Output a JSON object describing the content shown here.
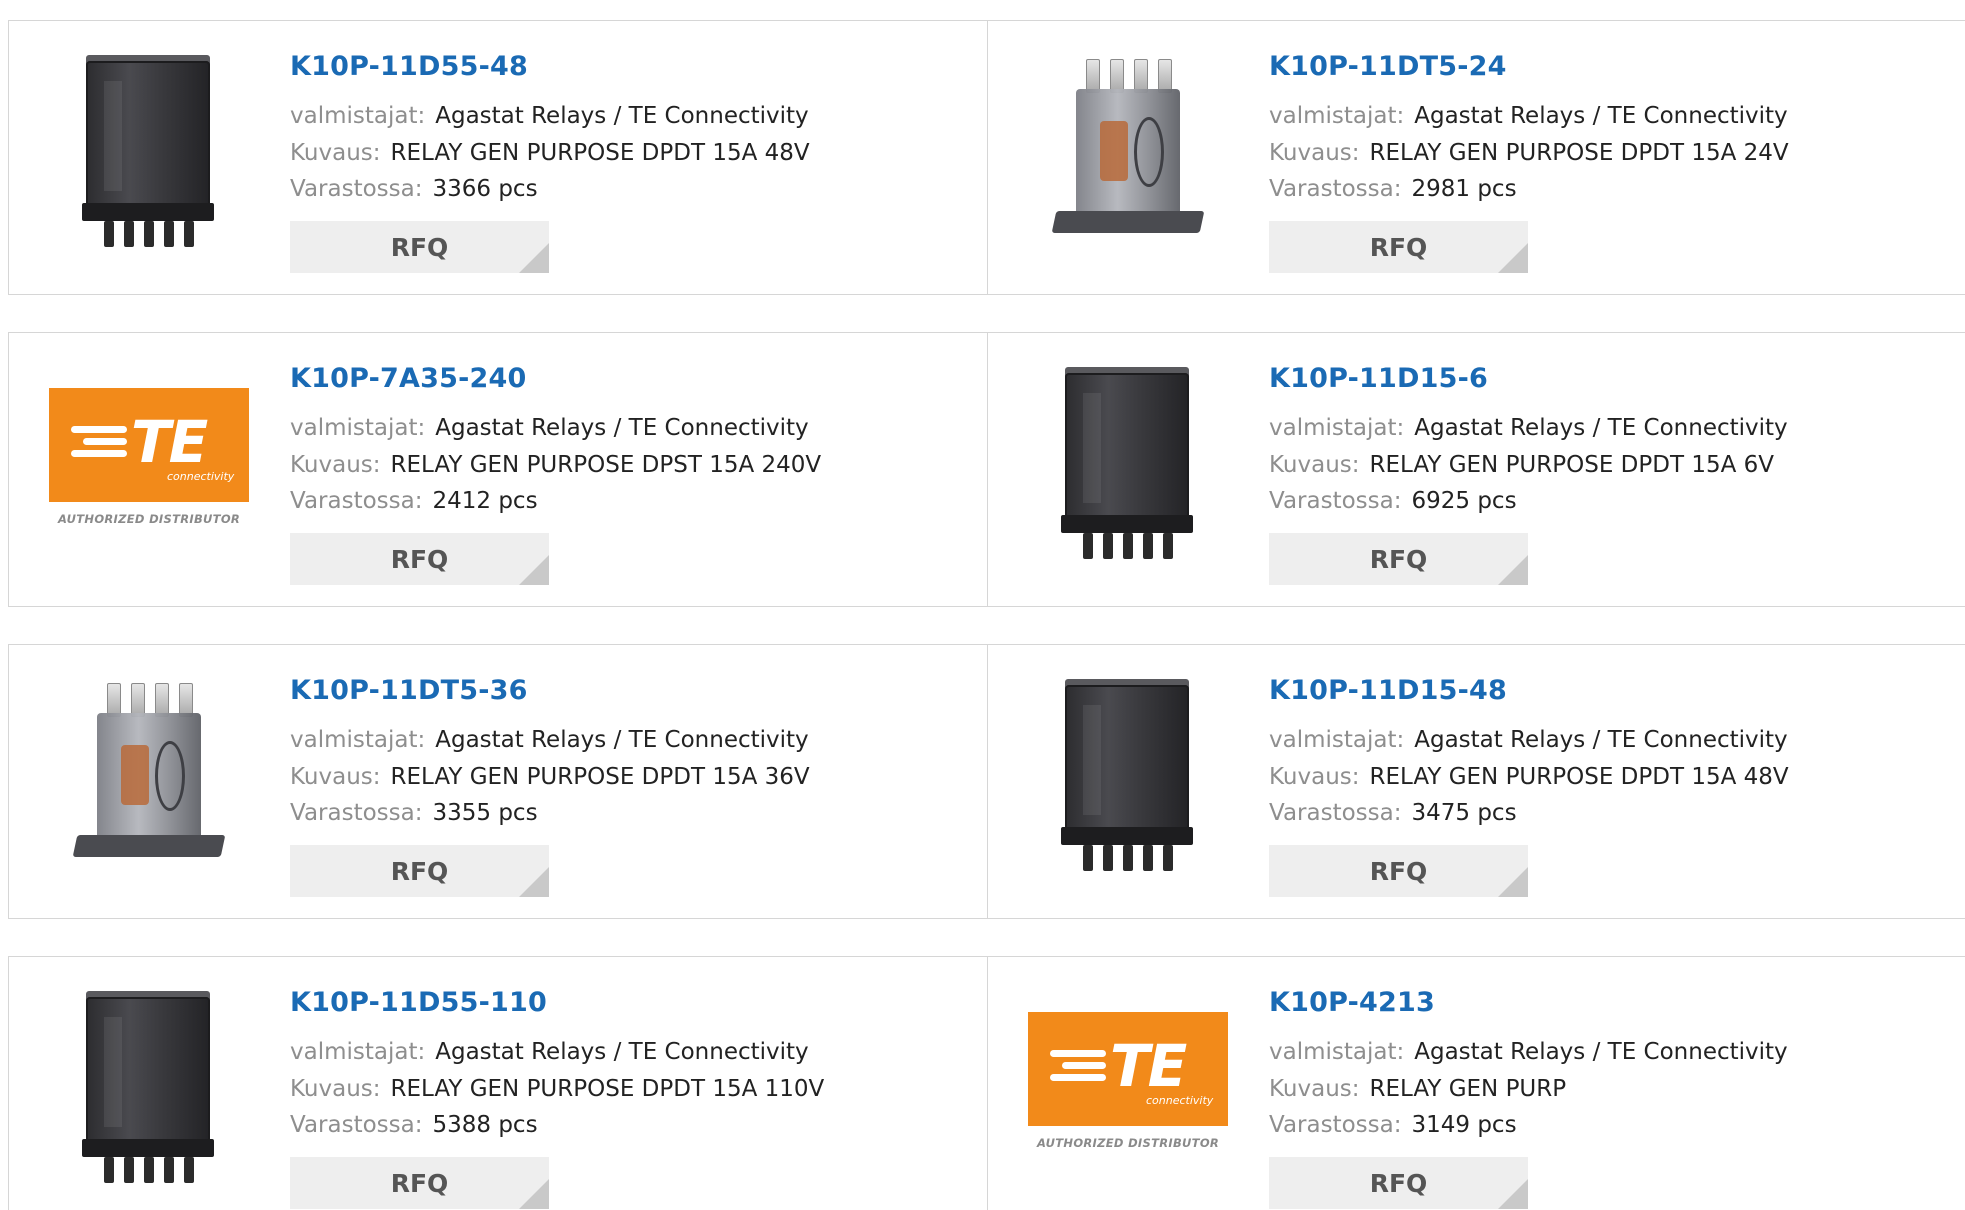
{
  "labels": {
    "manufacturer": "valmistajat:",
    "description": "Kuvaus:",
    "stock": "Varastossa:",
    "rfq": "RFQ"
  },
  "logo": {
    "brand": "TE",
    "sub": "connectivity",
    "authorized": "AUTHORIZED DISTRIBUTOR"
  },
  "products": [
    {
      "part": "K10P-11D55-48",
      "manufacturer": "Agastat Relays / TE Connectivity",
      "description": "RELAY GEN PURPOSE DPDT 15A 48V",
      "stock": "3366 pcs",
      "image": "relay-dark"
    },
    {
      "part": "K10P-11DT5-24",
      "manufacturer": "Agastat Relays / TE Connectivity",
      "description": "RELAY GEN PURPOSE DPDT 15A 24V",
      "stock": "2981 pcs",
      "image": "relay-clear"
    },
    {
      "part": "K10P-7A35-240",
      "manufacturer": "Agastat Relays / TE Connectivity",
      "description": "RELAY GEN PURPOSE DPST 15A 240V",
      "stock": "2412 pcs",
      "image": "te-logo"
    },
    {
      "part": "K10P-11D15-6",
      "manufacturer": "Agastat Relays / TE Connectivity",
      "description": "RELAY GEN PURPOSE DPDT 15A 6V",
      "stock": "6925 pcs",
      "image": "relay-dark"
    },
    {
      "part": "K10P-11DT5-36",
      "manufacturer": "Agastat Relays / TE Connectivity",
      "description": "RELAY GEN PURPOSE DPDT 15A 36V",
      "stock": "3355 pcs",
      "image": "relay-clear"
    },
    {
      "part": "K10P-11D15-48",
      "manufacturer": "Agastat Relays / TE Connectivity",
      "description": "RELAY GEN PURPOSE DPDT 15A 48V",
      "stock": "3475 pcs",
      "image": "relay-dark"
    },
    {
      "part": "K10P-11D55-110",
      "manufacturer": "Agastat Relays / TE Connectivity",
      "description": "RELAY GEN PURPOSE DPDT 15A 110V",
      "stock": "5388 pcs",
      "image": "relay-dark"
    },
    {
      "part": "K10P-4213",
      "manufacturer": "Agastat Relays / TE Connectivity",
      "description": "RELAY GEN PURP",
      "stock": "3149 pcs",
      "image": "te-logo"
    }
  ]
}
